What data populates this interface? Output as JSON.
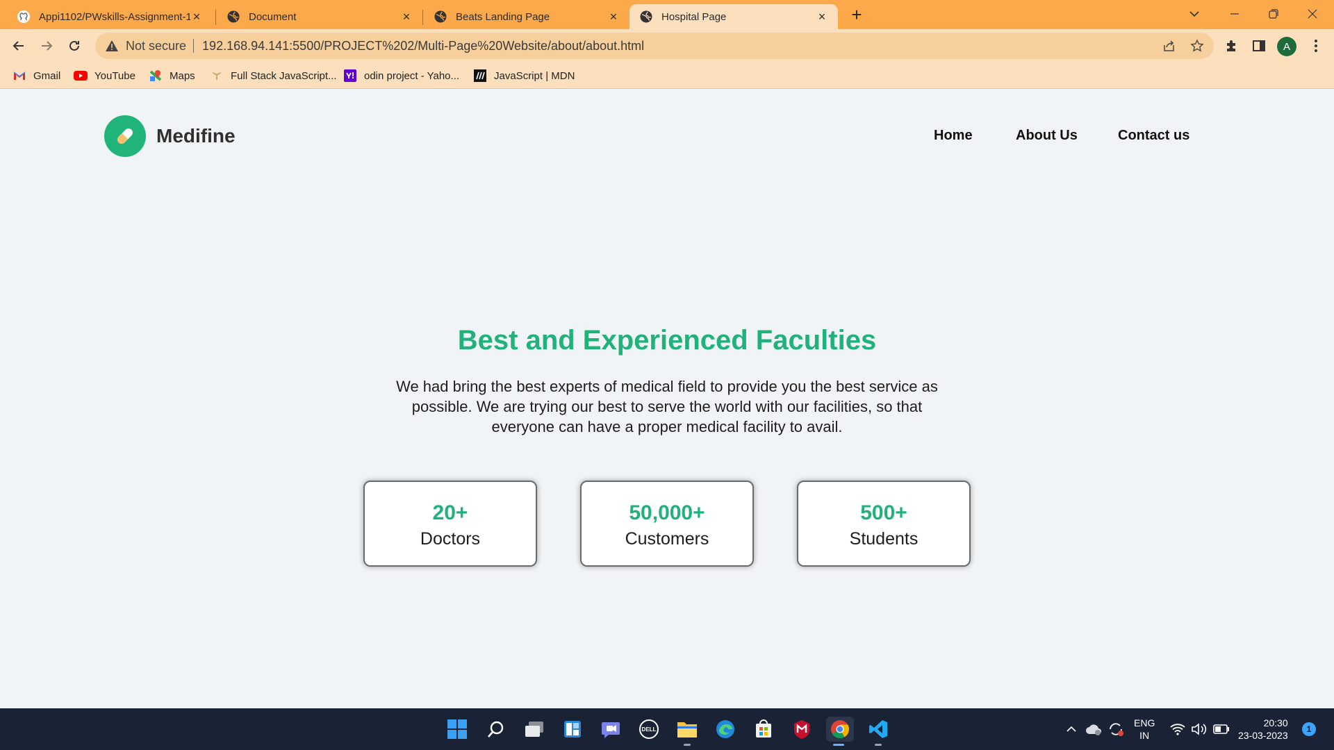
{
  "browser": {
    "tabs": [
      {
        "title": "Appi1102/PWskills-Assignment-1",
        "favicon": "github-icon"
      },
      {
        "title": "Document",
        "favicon": "globe-icon"
      },
      {
        "title": "Beats Landing Page",
        "favicon": "globe-icon"
      },
      {
        "title": "Hospital Page",
        "favicon": "globe-icon",
        "active": true
      }
    ],
    "omnibox": {
      "security_label": "Not secure",
      "url": "192.168.94.141:5500/PROJECT%202/Multi-Page%20Website/about/about.html"
    },
    "profile_initial": "A",
    "bookmarks": [
      {
        "label": "Gmail",
        "icon": "gmail-icon"
      },
      {
        "label": "YouTube",
        "icon": "youtube-icon"
      },
      {
        "label": "Maps",
        "icon": "maps-icon"
      },
      {
        "label": "Full Stack JavaScript...",
        "icon": "odin-icon"
      },
      {
        "label": "odin project - Yaho...",
        "icon": "yahoo-icon"
      },
      {
        "label": "JavaScript | MDN",
        "icon": "mdn-icon"
      }
    ],
    "theme_color": "#fba94a"
  },
  "site": {
    "brand": "Medifine",
    "nav": [
      "Home",
      "About Us",
      "Contact us"
    ],
    "hero": {
      "title": "Best and Experienced Faculties",
      "description": "We had bring the best experts of medical field to provide you the best service as possible. We are trying our best to serve the world with our facilities, so that everyone can have a proper medical facility to avail."
    },
    "stats": [
      {
        "value": "20+",
        "label": "Doctors"
      },
      {
        "value": "50,000+",
        "label": "Customers"
      },
      {
        "value": "500+",
        "label": "Students"
      }
    ],
    "accent_color": "#21b17b"
  },
  "taskbar": {
    "apps": [
      "windows-start-icon",
      "search-icon",
      "task-view-icon",
      "widgets-icon",
      "teams-chat-icon",
      "dell-icon",
      "file-explorer-icon",
      "edge-icon",
      "store-icon",
      "mcafee-icon",
      "chrome-icon",
      "vscode-icon"
    ],
    "language": {
      "line1": "ENG",
      "line2": "IN"
    },
    "time": "20:30",
    "date": "23-03-2023",
    "notification_count": "1"
  }
}
